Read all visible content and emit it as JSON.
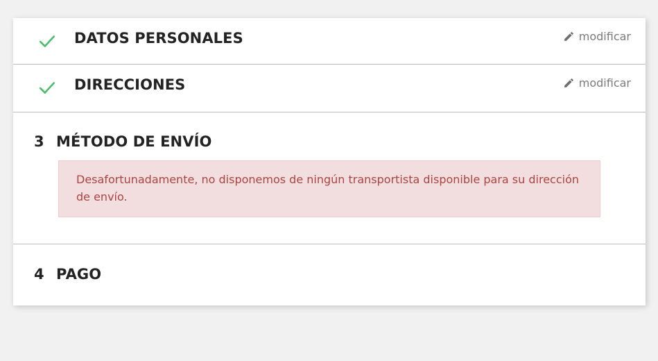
{
  "steps": {
    "personal": {
      "title": "DATOS PERSONALES",
      "edit_label": "modificar",
      "icon": "check-icon"
    },
    "addresses": {
      "title": "DIRECCIONES",
      "edit_label": "modificar",
      "icon": "check-icon"
    },
    "shipping": {
      "number": "3",
      "title": "MÉTODO DE ENVÍO",
      "alert": "Desafortunadamente, no disponemos de ningún transportista disponible para su dirección de envío."
    },
    "payment": {
      "number": "4",
      "title": "PAGO"
    }
  },
  "colors": {
    "check": "#4cbb6c",
    "alert_bg": "#f2dede",
    "alert_text": "#a94442",
    "edit_text": "#7a7a7a",
    "title_text": "#232323"
  }
}
